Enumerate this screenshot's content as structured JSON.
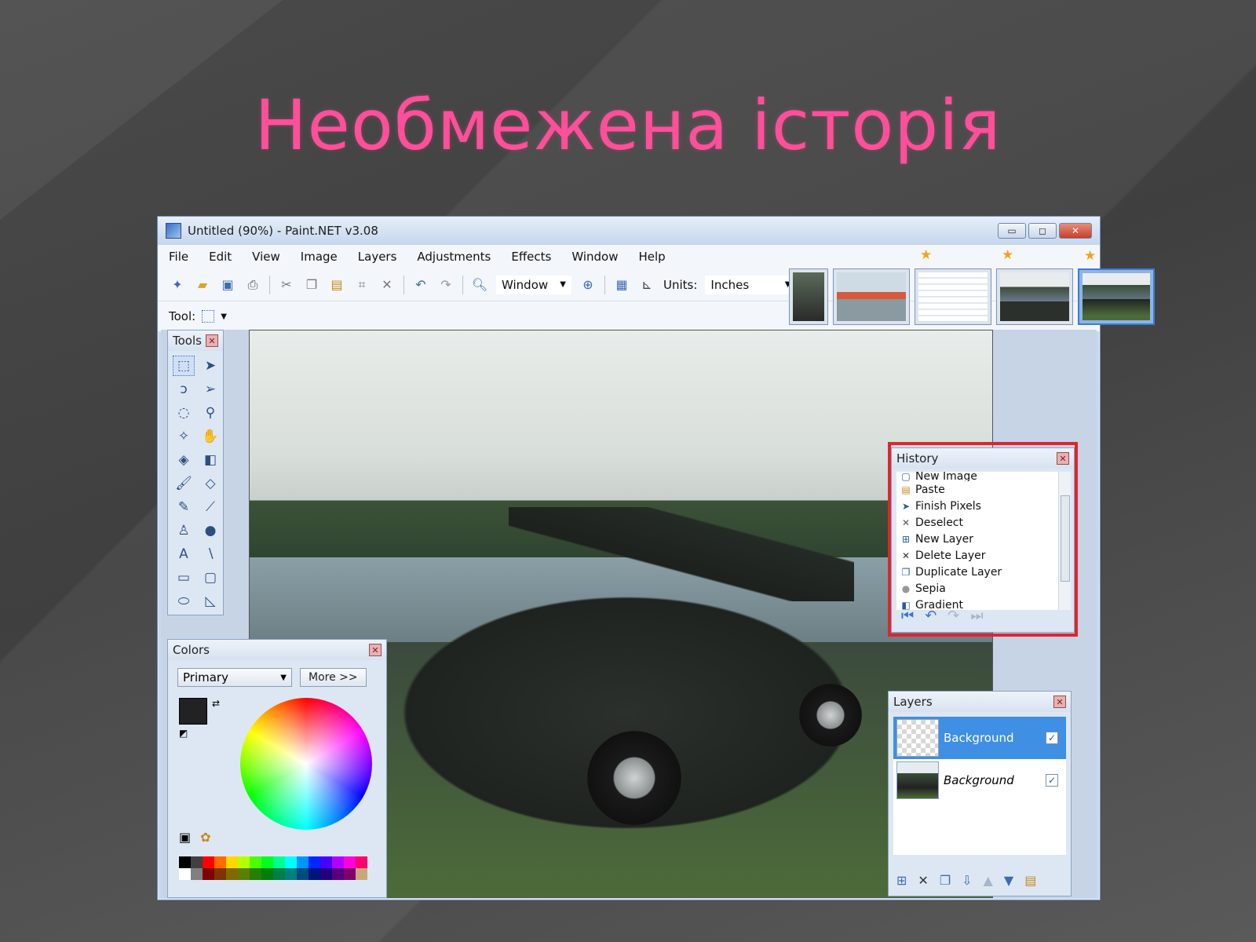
{
  "slide": {
    "title": "Необмежена історія"
  },
  "window": {
    "title": "Untitled (90%) - Paint.NET v3.08",
    "buttons": {
      "minimize": "▭",
      "maximize": "◻",
      "close": "✕"
    }
  },
  "menu": [
    "File",
    "Edit",
    "View",
    "Image",
    "Layers",
    "Adjustments",
    "Effects",
    "Window",
    "Help"
  ],
  "toolbar": {
    "zoom_value": "Window",
    "units_label": "Units:",
    "units_value": "Inches",
    "tool_label": "Tool:"
  },
  "tools_panel": {
    "title": "Tools"
  },
  "history_panel": {
    "title": "History",
    "items": [
      {
        "label": "New Image"
      },
      {
        "label": "Paste"
      },
      {
        "label": "Finish Pixels"
      },
      {
        "label": "Deselect"
      },
      {
        "label": "New Layer"
      },
      {
        "label": "Delete Layer"
      },
      {
        "label": "Duplicate Layer"
      },
      {
        "label": "Sepia"
      },
      {
        "label": "Gradient"
      }
    ]
  },
  "colors_panel": {
    "title": "Colors",
    "mode": "Primary",
    "more_button": "More >>",
    "primary_color": "#222222",
    "secondary_color": "#ffffff"
  },
  "layers_panel": {
    "title": "Layers",
    "layers": [
      {
        "name": "Background",
        "selected": true,
        "visible": true
      },
      {
        "name": "Background",
        "selected": false,
        "visible": true
      }
    ]
  },
  "colors": {
    "title_pink": "#ff4f9a",
    "highlight_red": "#e0242f",
    "selection_blue": "#3f8fe5"
  }
}
